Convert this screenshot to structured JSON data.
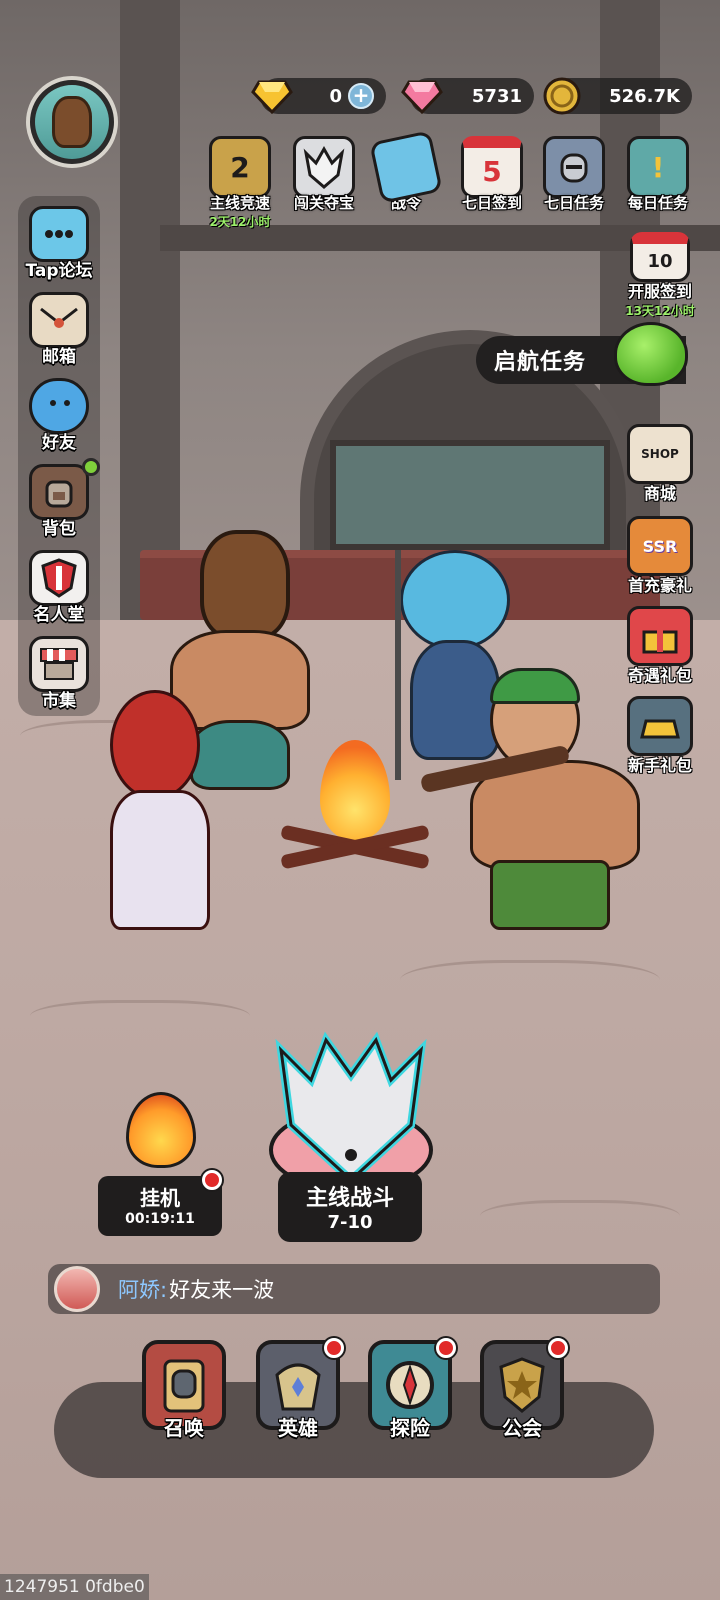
{
  "header": {
    "currencies": [
      {
        "name": "diamond",
        "amount": "0",
        "icon": "yellow-diamond-icon"
      },
      {
        "name": "gem",
        "amount": "5731",
        "icon": "pink-gem-icon"
      },
      {
        "name": "coin",
        "amount": "526.7K",
        "icon": "gold-coin-icon"
      }
    ]
  },
  "events": [
    {
      "label": "主线竞速",
      "timer": "2天12小时",
      "icon": "trophy-icon",
      "badge": "2"
    },
    {
      "label": "闯关夺宝",
      "icon": "wolf-mask-icon"
    },
    {
      "label": "战令",
      "icon": "crystal-icon"
    },
    {
      "label": "七日签到",
      "icon": "calendar-icon",
      "badge": "5"
    },
    {
      "label": "七日任务",
      "icon": "helmet-icon"
    },
    {
      "label": "每日任务",
      "icon": "book-icon"
    }
  ],
  "left_menu": [
    {
      "label": "Tap论坛",
      "icon": "chat-bubble-icon"
    },
    {
      "label": "邮箱",
      "icon": "envelope-icon"
    },
    {
      "label": "好友",
      "icon": "friends-icon"
    },
    {
      "label": "背包",
      "icon": "backpack-icon"
    },
    {
      "label": "名人堂",
      "icon": "shield-icon"
    },
    {
      "label": "市集",
      "icon": "market-stall-icon"
    }
  ],
  "right_menu": {
    "server_checkin": {
      "label": "开服签到",
      "timer": "13天12小时",
      "badge": "10"
    },
    "voyage_task": {
      "label": "启航任务"
    },
    "items": [
      {
        "label": "商城",
        "icon": "shop-bag-icon",
        "badge": "SHOP"
      },
      {
        "label": "首充豪礼",
        "icon": "tiger-icon",
        "badge": "SSR"
      },
      {
        "label": "奇遇礼包",
        "icon": "gift-box-icon"
      },
      {
        "label": "新手礼包",
        "icon": "gold-ingot-icon"
      }
    ]
  },
  "battle": {
    "idle": {
      "label": "挂机",
      "time": "00:19:11"
    },
    "main": {
      "label": "主线战斗",
      "stage": "7-10"
    }
  },
  "chat": {
    "name": "阿娇:",
    "message": "好友来一波"
  },
  "dock": [
    {
      "label": "召唤",
      "icon": "summon-book-icon"
    },
    {
      "label": "英雄",
      "icon": "hero-helmet-icon"
    },
    {
      "label": "探险",
      "icon": "compass-icon"
    },
    {
      "label": "公会",
      "icon": "guild-star-icon"
    }
  ],
  "debug_id": "1247951 0fdbe0",
  "colors": {
    "accent_green": "#9df06b",
    "badge_red": "#e12a2a",
    "chat_name": "#8ec8ff",
    "panel_dark": "#1f1d1d"
  }
}
